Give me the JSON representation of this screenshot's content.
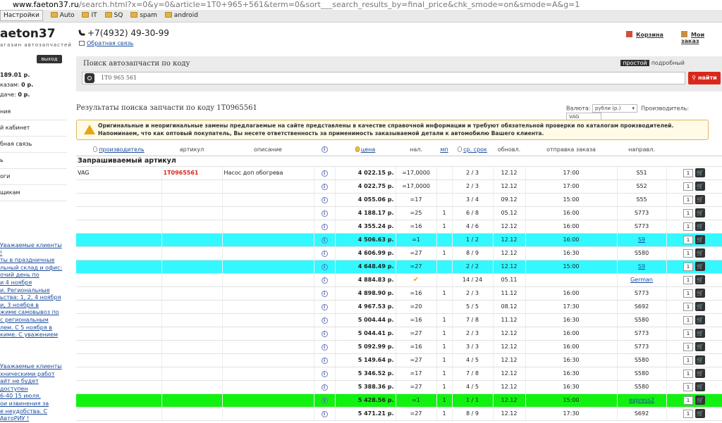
{
  "browser": {
    "url_host": "www.faeton37.ru",
    "url_rest": "/search.html?x=0&y=0&article=1T0+965+561&term=0&sort___search_results_by=final_price&chk_smode=on&smode=A&g=1",
    "bookmarks": [
      "Настройки",
      "Auto",
      "IT",
      "SQ",
      "spam",
      "android"
    ]
  },
  "header": {
    "logo": "aeton37",
    "logo_sub": "агазин автозапчастей",
    "phone": "+7(4932) 49-30-99",
    "feedback": "Обратная связь",
    "cart": "Корзина",
    "orders": "Мои заказ"
  },
  "sidebar": {
    "logout": "выход",
    "balance": "189.01 р.",
    "orders_label": "казам:",
    "orders_value": "0 р.",
    "issue_label": "дачe:",
    "issue_value": "0 р.",
    "menu": [
      "ния",
      "й кабинет",
      "бная связь",
      "ь",
      "оги",
      "щикам"
    ],
    "news1": [
      "Уважаемые клиенты !",
      "ты в праздничные",
      "льный склад и офис:",
      "очий день по",
      "и 4 ноября",
      "и. Региональные",
      "ьства: 1, 2, 4 ноября",
      "и, 3 ноября в",
      "жиме самовывоз по",
      "с региональным",
      "лем. С 5 ноября в",
      "киме. С уважением"
    ],
    "news2": [
      "Уважаемые клиенты",
      "хническими работ",
      "айт не будет доступен",
      "6-40 15 июля.",
      "ои извинения за",
      "е неудобства. С",
      "АвтоРИУ !"
    ]
  },
  "search": {
    "title": "Поиск автозапчасти по коду",
    "tab_simple": "простой",
    "tab_detailed": "подробный",
    "value": "1T0 965 561",
    "button": "найти"
  },
  "results": {
    "title": "Результаты поиска запчасти по коду 1T0965561",
    "currency_label": "Валюта:",
    "currency_value": "рубли (р.)",
    "maker_label": "Производитель:",
    "maker_value": "VAG",
    "warning_line1": "Оригинальные и неоригинальные замены предлагаемые на сайте представлены в качестве справочной информации и требуют обязательной проверки по каталогам производителей.",
    "warning_line2": "Напоминаем, что как оптовый покупатель, Вы несете ответственность за применимость заказываемой детали к автомобилю Вашего клиента.",
    "columns": [
      "производитель",
      "артикул",
      "описание",
      "",
      "цена",
      "нал.",
      "мп",
      "ср. срок",
      "обновл.",
      "отправка заказа",
      "направл."
    ],
    "group_label": "Запрашиваемый артикул",
    "rows": [
      {
        "maker": "VAG",
        "article": "1T0965561",
        "desc": "Насос доп обогрева",
        "price": "4 022.15 р.",
        "avail": "=17,0000",
        "mp": "",
        "term": "2 / 3",
        "updated": "12.12",
        "ship": "17:00",
        "dir": "S51",
        "hl": "",
        "qty": "1"
      },
      {
        "maker": "",
        "article": "",
        "desc": "",
        "price": "4 022.75 р.",
        "avail": "=17,0000",
        "mp": "",
        "term": "2 / 3",
        "updated": "12.12",
        "ship": "17:00",
        "dir": "S52",
        "hl": "",
        "qty": "1"
      },
      {
        "maker": "",
        "article": "",
        "desc": "",
        "price": "4 055.06 р.",
        "avail": "=17",
        "mp": "",
        "term": "3 / 4",
        "updated": "09.12",
        "ship": "15:00",
        "dir": "S55",
        "hl": "",
        "qty": "1"
      },
      {
        "maker": "",
        "article": "",
        "desc": "",
        "price": "4 188.17 р.",
        "avail": "=25",
        "mp": "1",
        "term": "6 / 8",
        "updated": "05.12",
        "ship": "16:00",
        "dir": "S773",
        "hl": "",
        "qty": "1"
      },
      {
        "maker": "",
        "article": "",
        "desc": "",
        "price": "4 355.24 р.",
        "avail": "=16",
        "mp": "1",
        "term": "4 / 6",
        "updated": "12.12",
        "ship": "16:00",
        "dir": "S773",
        "hl": "",
        "qty": "1"
      },
      {
        "maker": "",
        "article": "",
        "desc": "",
        "price": "4 506.63 р.",
        "avail": "=1",
        "mp": "",
        "term": "1 / 2",
        "updated": "12.12",
        "ship": "16:00",
        "dir": "S9",
        "hl": "cyan",
        "qty": "1"
      },
      {
        "maker": "",
        "article": "",
        "desc": "",
        "price": "4 606.99 р.",
        "avail": "=27",
        "mp": "1",
        "term": "8 / 9",
        "updated": "12.12",
        "ship": "16:30",
        "dir": "S580",
        "hl": "",
        "qty": "1"
      },
      {
        "maker": "",
        "article": "",
        "desc": "",
        "price": "4 648.49 р.",
        "avail": "=27",
        "mp": "",
        "term": "2 / 2",
        "updated": "12.12",
        "ship": "15:00",
        "dir": "S9",
        "hl": "cyan",
        "qty": "1"
      },
      {
        "maker": "",
        "article": "",
        "desc": "",
        "price": "4 884.83 р.",
        "avail": "✔",
        "mp": "",
        "term": "14 / 24",
        "updated": "05.11",
        "ship": "",
        "dir": "German",
        "hl": "",
        "qty": "1"
      },
      {
        "maker": "",
        "article": "",
        "desc": "",
        "price": "4 898.90 р.",
        "avail": "=16",
        "mp": "1",
        "term": "2 / 3",
        "updated": "11.12",
        "ship": "16:00",
        "dir": "S773",
        "hl": "",
        "qty": "1"
      },
      {
        "maker": "",
        "article": "",
        "desc": "",
        "price": "4 967.53 р.",
        "avail": "=20",
        "mp": "",
        "term": "5 / 5",
        "updated": "08.12",
        "ship": "17:30",
        "dir": "S692",
        "hl": "",
        "qty": "1"
      },
      {
        "maker": "",
        "article": "",
        "desc": "",
        "price": "5 004.44 р.",
        "avail": "=16",
        "mp": "1",
        "term": "7 / 8",
        "updated": "11.12",
        "ship": "16:30",
        "dir": "S580",
        "hl": "",
        "qty": "1"
      },
      {
        "maker": "",
        "article": "",
        "desc": "",
        "price": "5 044.41 р.",
        "avail": "=27",
        "mp": "1",
        "term": "2 / 3",
        "updated": "12.12",
        "ship": "16:00",
        "dir": "S773",
        "hl": "",
        "qty": "1"
      },
      {
        "maker": "",
        "article": "",
        "desc": "",
        "price": "5 092.99 р.",
        "avail": "=16",
        "mp": "1",
        "term": "3 / 3",
        "updated": "12.12",
        "ship": "16:00",
        "dir": "S773",
        "hl": "",
        "qty": "1"
      },
      {
        "maker": "",
        "article": "",
        "desc": "",
        "price": "5 149.64 р.",
        "avail": "=27",
        "mp": "1",
        "term": "4 / 5",
        "updated": "12.12",
        "ship": "16:30",
        "dir": "S580",
        "hl": "",
        "qty": "1"
      },
      {
        "maker": "",
        "article": "",
        "desc": "",
        "price": "5 346.52 р.",
        "avail": "=17",
        "mp": "1",
        "term": "7 / 8",
        "updated": "12.12",
        "ship": "16:30",
        "dir": "S580",
        "hl": "",
        "qty": "1"
      },
      {
        "maker": "",
        "article": "",
        "desc": "",
        "price": "5 388.36 р.",
        "avail": "=27",
        "mp": "1",
        "term": "4 / 5",
        "updated": "12.12",
        "ship": "16:30",
        "dir": "S580",
        "hl": "",
        "qty": "1"
      },
      {
        "maker": "",
        "article": "",
        "desc": "",
        "price": "5 428.56 р.",
        "avail": "=1",
        "mp": "1",
        "term": "1 / 1",
        "updated": "12.12",
        "ship": "15:00",
        "dir": "express2",
        "hl": "green",
        "qty": "1"
      },
      {
        "maker": "",
        "article": "",
        "desc": "",
        "price": "5 471.21 р.",
        "avail": "=27",
        "mp": "1",
        "term": "8 / 9",
        "updated": "12.12",
        "ship": "17:30",
        "dir": "S692",
        "hl": "",
        "qty": "1"
      }
    ]
  }
}
